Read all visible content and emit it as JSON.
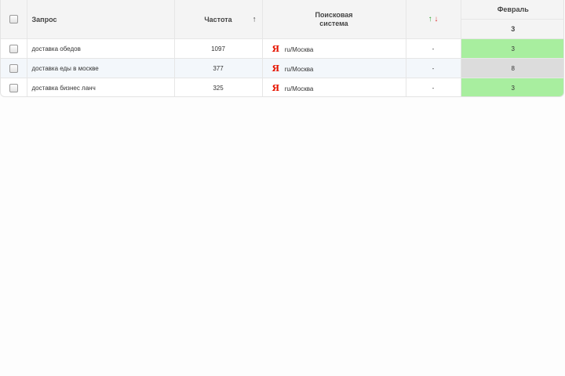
{
  "header": {
    "query_label": "Запрос",
    "frequency_label": "Частота",
    "sort_arrow": "↑",
    "search_engine_line1": "Поисковая",
    "search_engine_line2": "система",
    "change_up": "↑",
    "change_down": "↓",
    "month_label": "Февраль",
    "month_position": "3"
  },
  "rows": [
    {
      "query": "доставка обедов",
      "frequency": "1097",
      "engine_icon": "Я",
      "region": "ru/Москва",
      "change": "-",
      "position": "3",
      "position_color": "#a8ee9f"
    },
    {
      "query": "доставка еды в москве",
      "frequency": "377",
      "engine_icon": "Я",
      "region": "ru/Москва",
      "change": "-",
      "position": "8",
      "position_color": "#dcdcdc"
    },
    {
      "query": "доставка бизнес ланч",
      "frequency": "325",
      "engine_icon": "Я",
      "region": "ru/Москва",
      "change": "-",
      "position": "3",
      "position_color": "#a8ee9f"
    }
  ]
}
